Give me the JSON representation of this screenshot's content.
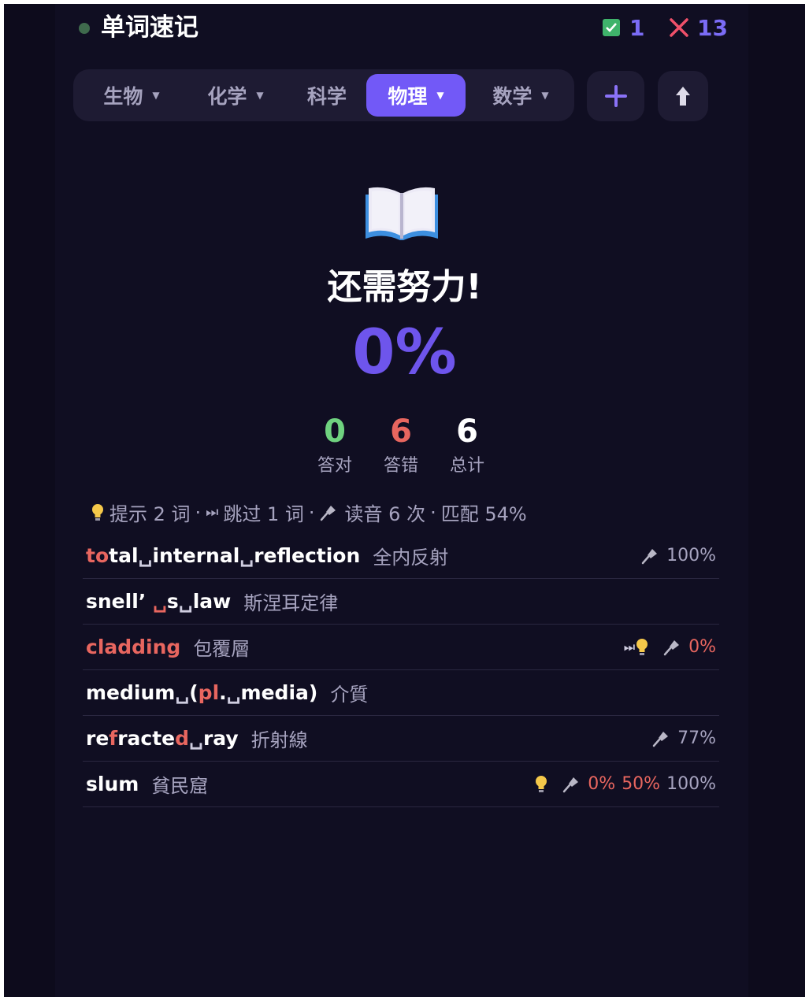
{
  "header": {
    "title": "单词速记",
    "correct_count": "1",
    "wrong_count": "13"
  },
  "tabs": [
    {
      "label": "生物",
      "caret": "▼",
      "active": false
    },
    {
      "label": "化学",
      "caret": "▼",
      "active": false
    },
    {
      "label": "科学",
      "caret": "",
      "active": false
    },
    {
      "label": "物理",
      "caret": "▼",
      "active": true
    },
    {
      "label": "数学",
      "caret": "▼",
      "active": false
    }
  ],
  "result": {
    "title": "还需努力!",
    "percent": "0%",
    "correct": {
      "value": "0",
      "label": "答对"
    },
    "wrong": {
      "value": "6",
      "label": "答错"
    },
    "total": {
      "value": "6",
      "label": "总计"
    }
  },
  "summary": {
    "hint": "提示 2 词",
    "sep1": "·",
    "skip": "跳过 1 词",
    "sep2": "·",
    "speak": "读音 6 次",
    "sep3": "·",
    "match": "匹配 54%"
  },
  "words": [
    {
      "segments": [
        {
          "t": "to",
          "c": "hl"
        },
        {
          "t": "tal",
          "c": ""
        },
        {
          "t": "␣",
          "c": "sp"
        },
        {
          "t": "internal",
          "c": ""
        },
        {
          "t": "␣",
          "c": "sp"
        },
        {
          "t": "reflection",
          "c": ""
        }
      ],
      "meaning": "全内反射",
      "score": "100%"
    },
    {
      "segments": [
        {
          "t": "snell’ ",
          "c": ""
        },
        {
          "t": "␣",
          "c": "sp red"
        },
        {
          "t": "s",
          "c": ""
        },
        {
          "t": "␣",
          "c": "sp"
        },
        {
          "t": "law",
          "c": ""
        }
      ],
      "meaning": "斯涅耳定律"
    },
    {
      "segments": [
        {
          "t": "cladding",
          "c": "hl"
        }
      ],
      "meaning": "包覆層",
      "score": "0%"
    },
    {
      "segments": [
        {
          "t": "medium",
          "c": ""
        },
        {
          "t": "␣",
          "c": "sp"
        },
        {
          "t": "(",
          "c": ""
        },
        {
          "t": "pl",
          "c": "hl"
        },
        {
          "t": ".",
          "c": ""
        },
        {
          "t": "␣",
          "c": "sp"
        },
        {
          "t": "media)",
          "c": ""
        }
      ],
      "meaning": "介質"
    },
    {
      "segments": [
        {
          "t": "re",
          "c": ""
        },
        {
          "t": "f",
          "c": "hl"
        },
        {
          "t": "racte",
          "c": ""
        },
        {
          "t": "d",
          "c": "hl"
        },
        {
          "t": "␣",
          "c": "sp"
        },
        {
          "t": "ray",
          "c": ""
        }
      ],
      "meaning": "折射線",
      "score": "77%"
    },
    {
      "segments": [
        {
          "t": "slum",
          "c": ""
        }
      ],
      "meaning": "貧民窟",
      "scores": [
        "0%",
        "50%",
        "100%"
      ]
    }
  ],
  "colors": {
    "accent": "#7259f7",
    "correct": "#6fd27f",
    "wrong": "#e8665f",
    "bg": "#100e22"
  }
}
